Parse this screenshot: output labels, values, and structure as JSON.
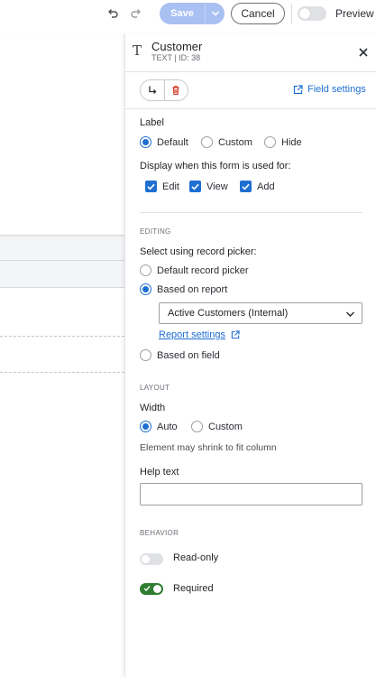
{
  "toolbar": {
    "undo_icon": "undo-icon",
    "redo_icon": "redo-icon",
    "save_label": "Save",
    "cancel_label": "Cancel",
    "preview_label": "Preview",
    "preview_on": false
  },
  "panel": {
    "field_type_glyph": "T",
    "title": "Customer",
    "subtitle": "TEXT | ID: 38",
    "field_settings_label": "Field settings",
    "label_section": {
      "heading": "Label",
      "options": [
        "Default",
        "Custom",
        "Hide"
      ],
      "selected": "Default"
    },
    "display_section": {
      "heading": "Display when this form is used for:",
      "options": [
        "Edit",
        "View",
        "Add"
      ],
      "checked": [
        "Edit",
        "View",
        "Add"
      ]
    },
    "editing": {
      "section_title": "EDITING",
      "heading": "Select using record picker:",
      "options": [
        "Default record picker",
        "Based on report",
        "Based on field"
      ],
      "selected": "Based on report",
      "report_value": "Active Customers (Internal)",
      "report_settings_label": "Report settings"
    },
    "layout": {
      "section_title": "LAYOUT",
      "width_heading": "Width",
      "width_options": [
        "Auto",
        "Custom"
      ],
      "width_selected": "Auto",
      "hint": "Element may shrink to fit column",
      "help_text_heading": "Help text",
      "help_text_value": ""
    },
    "behavior": {
      "section_title": "BEHAVIOR",
      "read_only_label": "Read-only",
      "read_only_on": false,
      "required_label": "Required",
      "required_on": true
    }
  },
  "colors": {
    "accent": "#1f6fd1",
    "save_disabled": "#a9c0f3",
    "toggle_on": "#2e7d32",
    "delete_red": "#d23b2b"
  }
}
